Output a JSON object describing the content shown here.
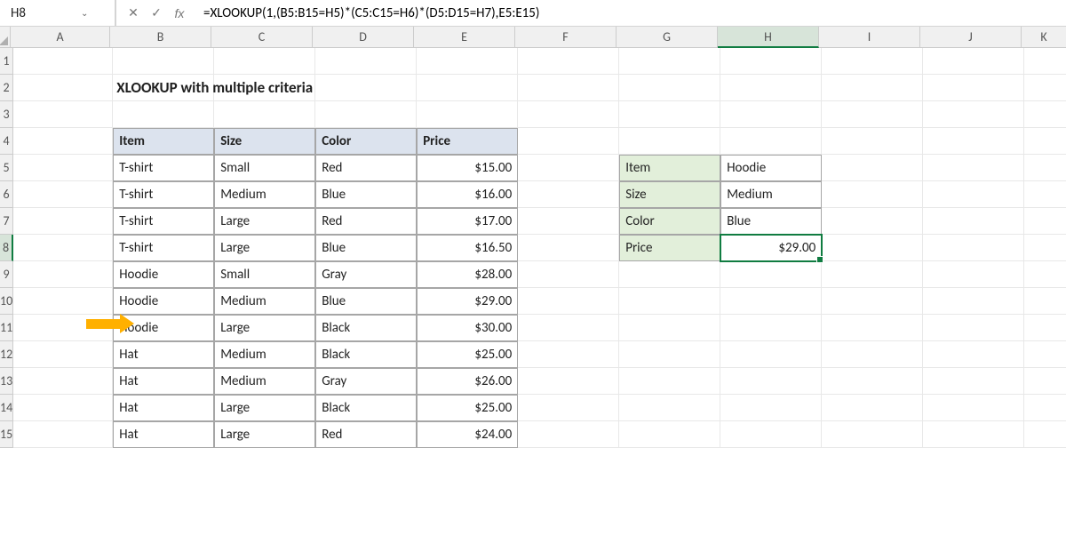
{
  "nameBox": "H8",
  "formula": "=XLOOKUP(1,(B5:B15=H5)*(C5:C15=H6)*(D5:D15=H7),E5:E15)",
  "columns": [
    "A",
    "B",
    "C",
    "D",
    "E",
    "F",
    "G",
    "H",
    "I",
    "J",
    "K"
  ],
  "rows": [
    "1",
    "2",
    "3",
    "4",
    "5",
    "6",
    "7",
    "8",
    "9",
    "10",
    "11",
    "12",
    "13",
    "14",
    "15"
  ],
  "title": "XLOOKUP with multiple criteria",
  "headers": {
    "item": "Item",
    "size": "Size",
    "color": "Color",
    "price": "Price"
  },
  "data": [
    {
      "item": "T-shirt",
      "size": "Small",
      "color": "Red",
      "price": "$15.00"
    },
    {
      "item": "T-shirt",
      "size": "Medium",
      "color": "Blue",
      "price": "$16.00"
    },
    {
      "item": "T-shirt",
      "size": "Large",
      "color": "Red",
      "price": "$17.00"
    },
    {
      "item": "T-shirt",
      "size": "Large",
      "color": "Blue",
      "price": "$16.50"
    },
    {
      "item": "Hoodie",
      "size": "Small",
      "color": "Gray",
      "price": "$28.00"
    },
    {
      "item": "Hoodie",
      "size": "Medium",
      "color": "Blue",
      "price": "$29.00"
    },
    {
      "item": "Hoodie",
      "size": "Large",
      "color": "Black",
      "price": "$30.00"
    },
    {
      "item": "Hat",
      "size": "Medium",
      "color": "Black",
      "price": "$25.00"
    },
    {
      "item": "Hat",
      "size": "Medium",
      "color": "Gray",
      "price": "$26.00"
    },
    {
      "item": "Hat",
      "size": "Large",
      "color": "Black",
      "price": "$25.00"
    },
    {
      "item": "Hat",
      "size": "Large",
      "color": "Red",
      "price": "$24.00"
    }
  ],
  "lookup": {
    "labels": {
      "item": "Item",
      "size": "Size",
      "color": "Color",
      "price": "Price"
    },
    "values": {
      "item": "Hoodie",
      "size": "Medium",
      "color": "Blue",
      "price": "$29.00"
    }
  }
}
